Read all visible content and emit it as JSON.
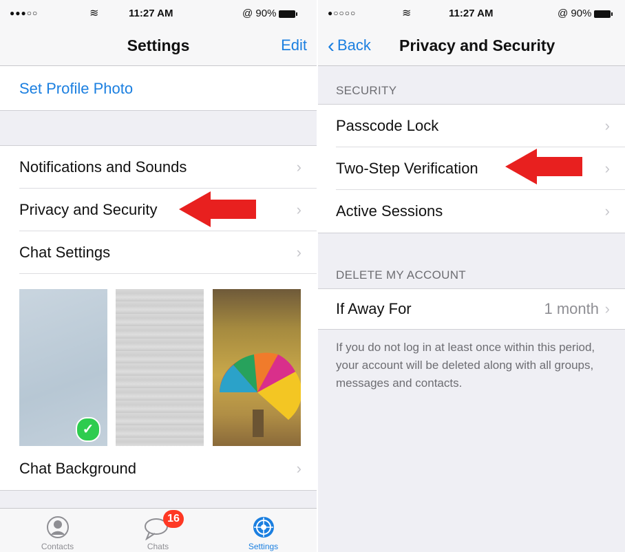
{
  "left": {
    "status": {
      "signal": "●●●○○",
      "time": "11:27 AM",
      "battery": "@ 90%"
    },
    "nav": {
      "title": "Settings",
      "edit": "Edit"
    },
    "set_profile_photo": "Set Profile Photo",
    "rows": [
      {
        "label": "Notifications and Sounds"
      },
      {
        "label": "Privacy and Security"
      },
      {
        "label": "Chat Settings"
      }
    ],
    "chat_background": "Chat Background",
    "tabs": [
      {
        "label": "Contacts",
        "icon": "contacts-icon"
      },
      {
        "label": "Chats",
        "icon": "chats-icon",
        "badge": "16"
      },
      {
        "label": "Settings",
        "icon": "settings-icon",
        "active": true
      }
    ]
  },
  "right": {
    "status": {
      "signal": "●○○○○",
      "time": "11:27 AM",
      "battery": "@ 90%"
    },
    "nav": {
      "back": "Back",
      "title": "Privacy and Security"
    },
    "security_header": "SECURITY",
    "security_rows": [
      {
        "label": "Passcode Lock"
      },
      {
        "label": "Two-Step Verification"
      },
      {
        "label": "Active Sessions"
      }
    ],
    "delete_header": "DELETE MY ACCOUNT",
    "away": {
      "label": "If Away For",
      "value": "1 month"
    },
    "footer_note": "If you do not log in at least once within this period, your account will be deleted along with all groups, messages and contacts."
  },
  "colors": {
    "accent": "#1b7fe0",
    "arrow": "#e8201f",
    "badge": "#fe3824",
    "check": "#2ecc4f"
  }
}
